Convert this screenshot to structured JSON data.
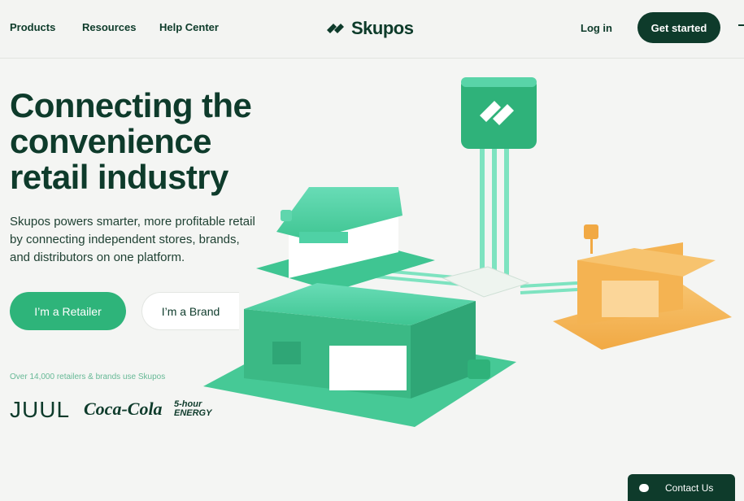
{
  "nav": {
    "products": "Products",
    "resources": "Resources",
    "help_center": "Help Center",
    "logo_text": "Skupos",
    "login": "Log in",
    "get_started": "Get started"
  },
  "hero": {
    "title_line1": "Connecting the",
    "title_line2": "convenience",
    "title_line3": "retail industry",
    "subtitle": "Skupos powers smarter, more profitable retail by connecting independent stores, brands, and distributors on one platform.",
    "retailer_button": "I’m a Retailer",
    "brand_button": "I’m a Brand"
  },
  "social_proof": {
    "text": "Over 14,000 retailers & brands use Skupos",
    "logos": [
      "JUUL",
      "Coca-Cola",
      "5-hour ENERGY"
    ]
  },
  "chat": {
    "label": "Contact Us",
    "icon": "chat-bubble-icon"
  },
  "colors": {
    "brand_dark": "#0e3b2b",
    "brand_green": "#2eb47a",
    "mint": "#4fd1a5",
    "orange": "#f3b04f"
  }
}
